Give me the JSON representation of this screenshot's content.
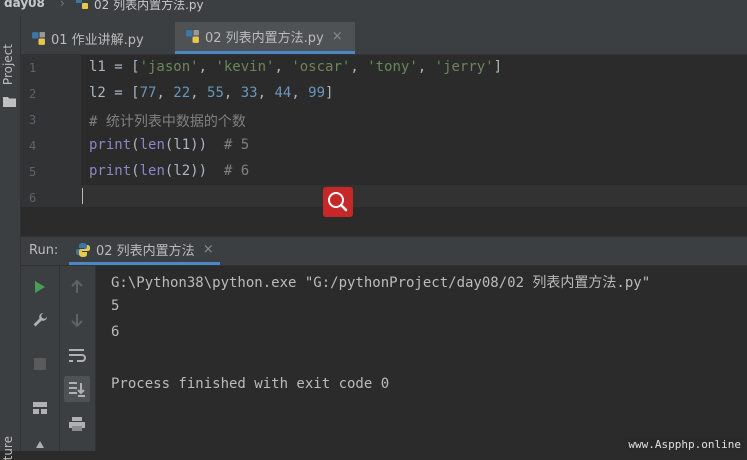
{
  "navbar": {
    "project": "day08",
    "separator": "›",
    "file": "02 列表内置方法.py"
  },
  "sidebar": {
    "project_label": "Project",
    "structure_label": "ture"
  },
  "tabs": [
    {
      "label": "01 作业讲解.py",
      "active": false
    },
    {
      "label": "02 列表内置方法.py",
      "active": true,
      "close": "×"
    }
  ],
  "editor": {
    "line_numbers": [
      "1",
      "2",
      "3",
      "4",
      "5",
      "6"
    ],
    "lines": [
      {
        "l1": "l1 = [",
        "s1": "'jason'",
        "c1": ", ",
        "s2": "'kevin'",
        "c2": ", ",
        "s3": "'oscar'",
        "c3": ", ",
        "s4": "'tony'",
        "c4": ", ",
        "s5": "'jerry'",
        "end": "]"
      },
      {
        "l2": "l2 = [",
        "n1": "77",
        "c1": ", ",
        "n2": "22",
        "c2": ", ",
        "n3": "55",
        "c3": ", ",
        "n4": "33",
        "c4": ", ",
        "n5": "44",
        "c5": ", ",
        "n6": "99",
        "end": "]"
      },
      {
        "comment": "# 统计列表中数据的个数"
      },
      {
        "fn": "print",
        "open": "(",
        "fn2": "len",
        "rest": "(l1))  ",
        "comment": "# 5"
      },
      {
        "fn": "print",
        "open": "(",
        "fn2": "len",
        "rest": "(l2))  ",
        "comment": "# 6"
      },
      {}
    ]
  },
  "run": {
    "label": "Run:",
    "tab_label": "02 列表内置方法",
    "close": "×"
  },
  "console": {
    "command": "G:\\Python38\\python.exe \"G:/pythonProject/day08/02 列表内置方法.py\"",
    "outputs": [
      "5",
      "6"
    ],
    "exit": "Process finished with exit code 0"
  },
  "watermark": "www.Aspphp.online",
  "colors": {
    "background": "#2b2b2b",
    "panel": "#3c3f41",
    "accent": "#4a88c7",
    "string": "#6a8759",
    "number": "#6897bb",
    "comment": "#808080",
    "builtin": "#8888c6",
    "search_overlay": "#c62828",
    "run_green": "#499c54"
  }
}
